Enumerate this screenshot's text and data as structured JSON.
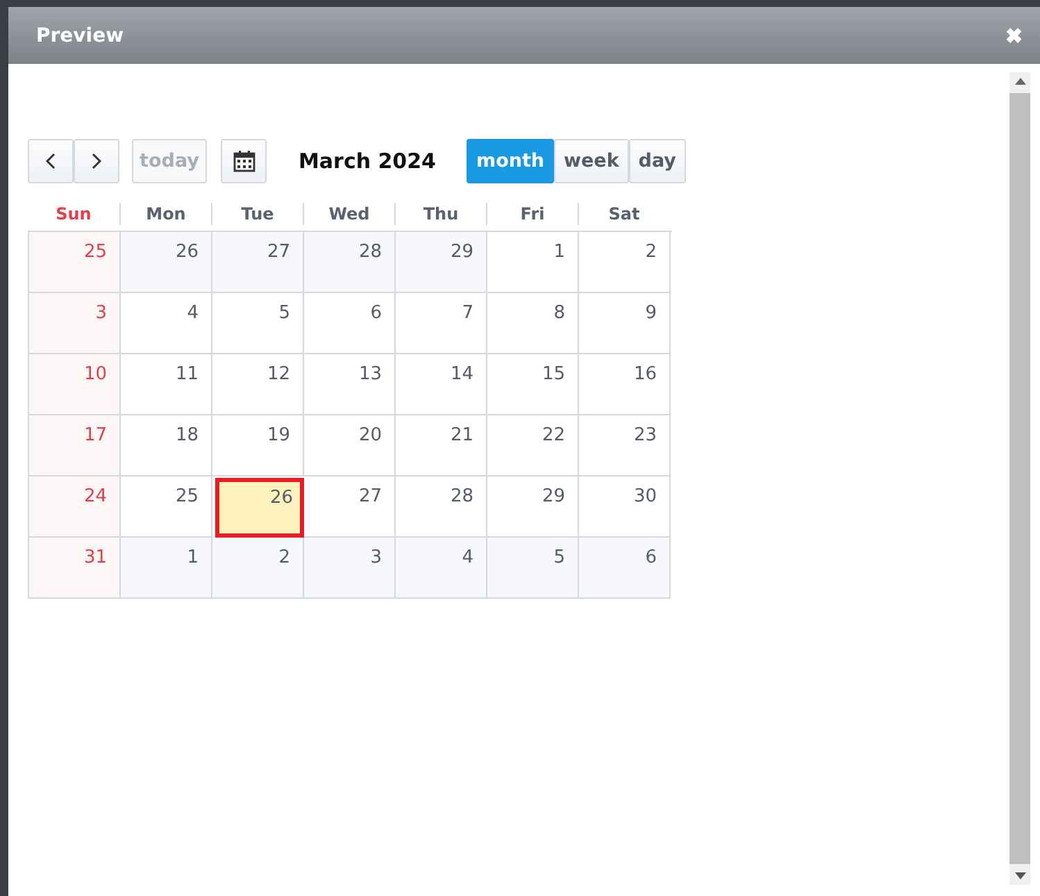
{
  "dialog": {
    "title": "Preview",
    "close": "✖"
  },
  "toolbar": {
    "today": {
      "label": "today",
      "disabled": true
    },
    "title": "March 2024",
    "views": [
      {
        "label": "month",
        "selected": true
      },
      {
        "label": "week",
        "selected": false
      },
      {
        "label": "day",
        "selected": false
      }
    ]
  },
  "weekdays": [
    {
      "label": "Sun",
      "weekend": true
    },
    {
      "label": "Mon",
      "weekend": false
    },
    {
      "label": "Tue",
      "weekend": false
    },
    {
      "label": "Wed",
      "weekend": false
    },
    {
      "label": "Thu",
      "weekend": false
    },
    {
      "label": "Fri",
      "weekend": false
    },
    {
      "label": "Sat",
      "weekend": false
    }
  ],
  "weeks": [
    [
      {
        "day": "25",
        "outside": true,
        "selected": false
      },
      {
        "day": "26",
        "outside": true,
        "selected": false
      },
      {
        "day": "27",
        "outside": true,
        "selected": false
      },
      {
        "day": "28",
        "outside": true,
        "selected": false
      },
      {
        "day": "29",
        "outside": true,
        "selected": false
      },
      {
        "day": "1",
        "outside": false,
        "selected": false
      },
      {
        "day": "2",
        "outside": false,
        "selected": false
      }
    ],
    [
      {
        "day": "3",
        "outside": false,
        "selected": false
      },
      {
        "day": "4",
        "outside": false,
        "selected": false
      },
      {
        "day": "5",
        "outside": false,
        "selected": false
      },
      {
        "day": "6",
        "outside": false,
        "selected": false
      },
      {
        "day": "7",
        "outside": false,
        "selected": false
      },
      {
        "day": "8",
        "outside": false,
        "selected": false
      },
      {
        "day": "9",
        "outside": false,
        "selected": false
      }
    ],
    [
      {
        "day": "10",
        "outside": false,
        "selected": false
      },
      {
        "day": "11",
        "outside": false,
        "selected": false
      },
      {
        "day": "12",
        "outside": false,
        "selected": false
      },
      {
        "day": "13",
        "outside": false,
        "selected": false
      },
      {
        "day": "14",
        "outside": false,
        "selected": false
      },
      {
        "day": "15",
        "outside": false,
        "selected": false
      },
      {
        "day": "16",
        "outside": false,
        "selected": false
      }
    ],
    [
      {
        "day": "17",
        "outside": false,
        "selected": false
      },
      {
        "day": "18",
        "outside": false,
        "selected": false
      },
      {
        "day": "19",
        "outside": false,
        "selected": false
      },
      {
        "day": "20",
        "outside": false,
        "selected": false
      },
      {
        "day": "21",
        "outside": false,
        "selected": false
      },
      {
        "day": "22",
        "outside": false,
        "selected": false
      },
      {
        "day": "23",
        "outside": false,
        "selected": false
      }
    ],
    [
      {
        "day": "24",
        "outside": false,
        "selected": false
      },
      {
        "day": "25",
        "outside": false,
        "selected": false
      },
      {
        "day": "26",
        "outside": false,
        "selected": true
      },
      {
        "day": "27",
        "outside": false,
        "selected": false
      },
      {
        "day": "28",
        "outside": false,
        "selected": false
      },
      {
        "day": "29",
        "outside": false,
        "selected": false
      },
      {
        "day": "30",
        "outside": false,
        "selected": false
      }
    ],
    [
      {
        "day": "31",
        "outside": false,
        "selected": false
      },
      {
        "day": "1",
        "outside": true,
        "selected": false
      },
      {
        "day": "2",
        "outside": true,
        "selected": false
      },
      {
        "day": "3",
        "outside": true,
        "selected": false
      },
      {
        "day": "4",
        "outside": true,
        "selected": false
      },
      {
        "day": "5",
        "outside": true,
        "selected": false
      },
      {
        "day": "6",
        "outside": true,
        "selected": false
      }
    ]
  ]
}
